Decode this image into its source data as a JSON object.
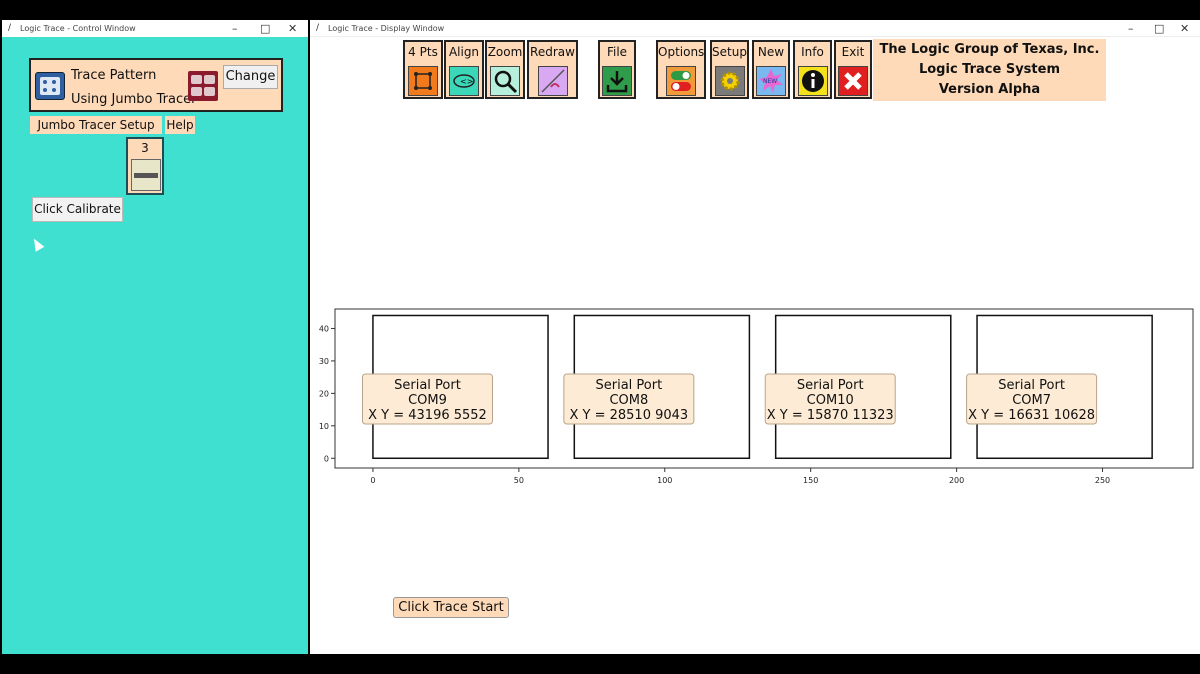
{
  "control_window": {
    "title": "Logic Trace - Control Window",
    "pattern_line1": "Trace Pattern",
    "pattern_line2": "Using Jumbo Tracer",
    "change_label": "Change",
    "menu": [
      "Jumbo Tracer Setup",
      "Help"
    ],
    "counter_value": "3",
    "calibrate_label": "Click Calibrate"
  },
  "display_window": {
    "title": "Logic Trace - Display Window",
    "toolbar": [
      {
        "label": "4 Pts",
        "icon": "square-points-icon",
        "color": "#f07a1c"
      },
      {
        "label": "Align",
        "icon": "align-eye-icon",
        "color": "#3cd7b9"
      },
      {
        "label": "Zoom",
        "icon": "magnifier-icon",
        "color": "#b6f0dc"
      },
      {
        "label": "Redraw",
        "icon": "redraw-icon",
        "color": "#d9a8f2"
      },
      {
        "label": "File",
        "icon": "download-icon",
        "color": "#2f9c4b"
      },
      {
        "label": "Options",
        "icon": "toggle-icon",
        "color": "#f09a3a"
      },
      {
        "label": "Setup",
        "icon": "gear-icon",
        "color": "#7a7a7a"
      },
      {
        "label": "New",
        "icon": "new-burst-icon",
        "color": "#79b8f0"
      },
      {
        "label": "Info",
        "icon": "info-icon",
        "color": "#f5e21a"
      },
      {
        "label": "Exit",
        "icon": "close-icon",
        "color": "#e02020"
      }
    ],
    "company": [
      "The Logic Group of Texas, Inc.",
      "Logic Trace System",
      "Version Alpha"
    ],
    "trace_start_label": "Click Trace Start"
  },
  "chart_data": {
    "type": "rectangles",
    "xlim": [
      -13,
      281
    ],
    "ylim": [
      -3,
      46
    ],
    "xticks": [
      0,
      50,
      100,
      150,
      200,
      250
    ],
    "yticks": [
      0,
      10,
      20,
      30,
      40
    ],
    "rects": [
      {
        "x0": 0,
        "x1": 60,
        "y0": 0,
        "y1": 44
      },
      {
        "x0": 69,
        "x1": 129,
        "y0": 0,
        "y1": 44
      },
      {
        "x0": 138,
        "x1": 198,
        "y0": 0,
        "y1": 44
      },
      {
        "x0": 207,
        "x1": 267,
        "y0": 0,
        "y1": 44
      }
    ],
    "labels": [
      {
        "title": "Serial Port",
        "port": "COM9",
        "xy": "X Y = 43196 5552"
      },
      {
        "title": "Serial Port",
        "port": "COM8",
        "xy": "X Y = 28510 9043"
      },
      {
        "title": "Serial Port",
        "port": "COM10",
        "xy": "X Y = 15870 11323"
      },
      {
        "title": "Serial Port",
        "port": "COM7",
        "xy": "X Y = 16631 10628"
      }
    ]
  }
}
